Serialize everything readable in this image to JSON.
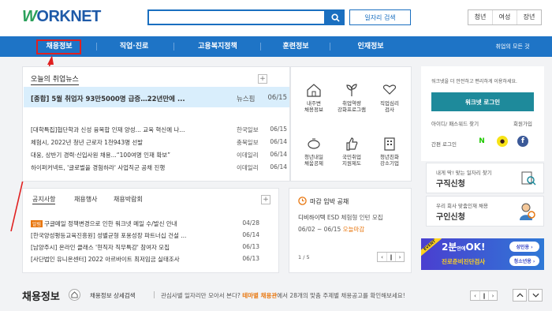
{
  "header": {
    "logo_w": "W",
    "logo_rest": "ORKNET",
    "search_placeholder": "",
    "job_search_label": "일자리 검색",
    "target_tabs": [
      "청년",
      "여성",
      "장년"
    ]
  },
  "nav": {
    "items": [
      "채용정보",
      "직업·진로",
      "고용복지정책",
      "훈련정보",
      "인재정보"
    ],
    "all_menu": "취업의 모든 것"
  },
  "news": {
    "title": "오늘의 취업뉴스",
    "plus": "+",
    "top": {
      "text": "[종합] 5월 취업자 93만5000명 급증…22년만에 ...",
      "source": "뉴스핌",
      "date": "06/15"
    },
    "rows": [
      {
        "text": "[대학특집]협단학과 신성 융복합 인재 양성... 교육 혁신에 나...",
        "source": "한국일보",
        "date": "06/15"
      },
      {
        "text": "체험시, 2022년 청년 근로자 1천943명 선발",
        "source": "충북일보",
        "date": "06/14"
      },
      {
        "text": "대웅, 상반기 경력·신입사원 채용...“100여명 인재 확보”",
        "source": "이데일리",
        "date": "06/14"
      },
      {
        "text": "하이퍼커넥트, '글로벌을 경험하라' 사업직군 공채 진행",
        "source": "이데일리",
        "date": "06/14"
      }
    ]
  },
  "quick_icons": [
    {
      "name": "house-icon",
      "label1": "내주변",
      "label2": "채용정보"
    },
    {
      "name": "plant-icon",
      "label1": "취업역량",
      "label2": "강화프로그램"
    },
    {
      "name": "heart-hand-icon",
      "label1": "직업심리",
      "label2": "검사"
    },
    {
      "name": "piggy-bank-icon",
      "label1": "청년내일",
      "label2": "채움공제"
    },
    {
      "name": "thumbs-up-icon",
      "label1": "국민취업",
      "label2": "지원제도"
    },
    {
      "name": "building-icon",
      "label1": "청년친화",
      "label2": "강소기업"
    }
  ],
  "login": {
    "desc": "워크넷을 더 안전하고 편리하게 이용하세요.",
    "button": "워크넷 로그인",
    "find": "아이디/ 패스워드 찾기",
    "join": "회원가입",
    "simple": "간편 로그인",
    "social": [
      "N",
      "●",
      "f"
    ],
    "colors": {
      "naver": "#1ec800",
      "kakao": "#f7e317",
      "facebook": "#3b5998"
    }
  },
  "job_apply": {
    "sub": "내게 딱! 맞는 일자리 찾기",
    "title": "구직신청"
  },
  "talent_apply": {
    "sub": "우리 회사 맞춤인재 채용",
    "title": "구인신청"
  },
  "notice": {
    "tabs": [
      "공지사항",
      "채용행사",
      "채용박람회"
    ],
    "plus": "+",
    "rows": [
      {
        "tag": "알림",
        "text": "구글메일 정책변경으로 인한 워크넷 메일 수/발신 안내",
        "date": "04/28"
      },
      {
        "tag": "",
        "text": "[한국양성평등교육진흥원] 성별균형 포용성장 파트너십 건설 ...",
        "date": "06/14"
      },
      {
        "tag": "",
        "text": "[남양주시] 온라인 클래스 '현직자 직무특강' 참여자 모집",
        "date": "06/13"
      },
      {
        "tag": "",
        "text": "[사단법인 유니온센터] 2022 아르바이트 최저임금 실태조사",
        "date": "06/13"
      }
    ]
  },
  "deadline": {
    "title": "마감 임박 공채",
    "company": "디비하이텍",
    "job": "ESD 체험형 인턴 모집",
    "period": "06/02 ~ 06/15",
    "status": "오늘마감",
    "page": "1 / 5"
  },
  "banner": {
    "event": "EVENT",
    "big": "2분",
    "mid": "안에",
    "ok": "OK!",
    "sub": "진로준비진단검사",
    "btn1": "성인용 ›",
    "btn2": "청소년용 ›"
  },
  "bottom": {
    "title": "채용정보",
    "detail": "채용정보 상세검색",
    "msg_pre": "관심사별 일자리만 모아서 본다?",
    "msg_hl": "테마별 채용관",
    "msg_post": "에서 28개의 맞춤 주제별 채용공고를 확인해보세요!"
  }
}
